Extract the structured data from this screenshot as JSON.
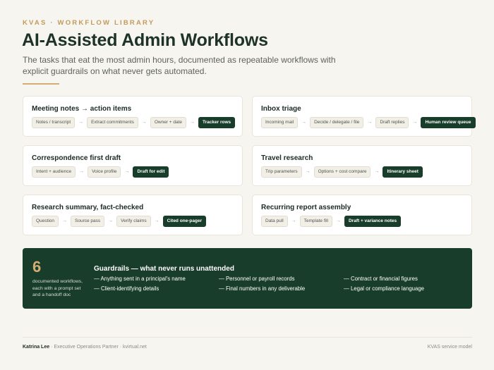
{
  "header": {
    "eyebrow": "KVAS · WORKFLOW LIBRARY",
    "title": "AI-Assisted Admin Workflows",
    "subtitle": "The tasks that eat the most admin hours, documented as repeatable workflows with explicit guardrails on what never gets automated."
  },
  "workflows": [
    {
      "title": "Meeting notes",
      "title_arrow": "→",
      "title_tail": "action items",
      "steps": [
        "Notes / transcript",
        "Extract commitments",
        "Owner + date"
      ],
      "final": "Tracker rows"
    },
    {
      "title": "Inbox triage",
      "steps": [
        "Incoming mail",
        "Decide / delegate / file",
        "Draft replies"
      ],
      "final": "Human review queue"
    },
    {
      "title": "Correspondence first draft",
      "steps": [
        "Intent + audience",
        "Voice profile"
      ],
      "final": "Draft for edit"
    },
    {
      "title": "Travel research",
      "steps": [
        "Trip parameters",
        "Options + cost compare"
      ],
      "final": "Itinerary sheet"
    },
    {
      "title": "Research summary, fact-checked",
      "steps": [
        "Question",
        "Source pass",
        "Verify claims"
      ],
      "final": "Cited one-pager"
    },
    {
      "title": "Recurring report assembly",
      "steps": [
        "Data pull",
        "Template fill"
      ],
      "final": "Draft + variance notes"
    }
  ],
  "arrow_glyph": "→",
  "summary": {
    "count": "6",
    "count_note": "documented workflows, each with a prompt set and a handoff doc"
  },
  "guardrails": {
    "title": "Guardrails — what never runs unattended",
    "items": [
      "— Anything sent in a principal's name",
      "— Personnel or payroll records",
      "— Contract or financial figures",
      "— Client-identifying details",
      "— Final numbers in any deliverable",
      "— Legal or compliance language"
    ]
  },
  "footer": {
    "name": "Katrina Lee",
    "role": " · Executive Operations Partner · kvirtual.net",
    "right": "KVAS service model"
  },
  "colors": {
    "accent_gold": "#d3ad74",
    "panel_green": "#183d2a",
    "background": "#f7f5ef"
  }
}
